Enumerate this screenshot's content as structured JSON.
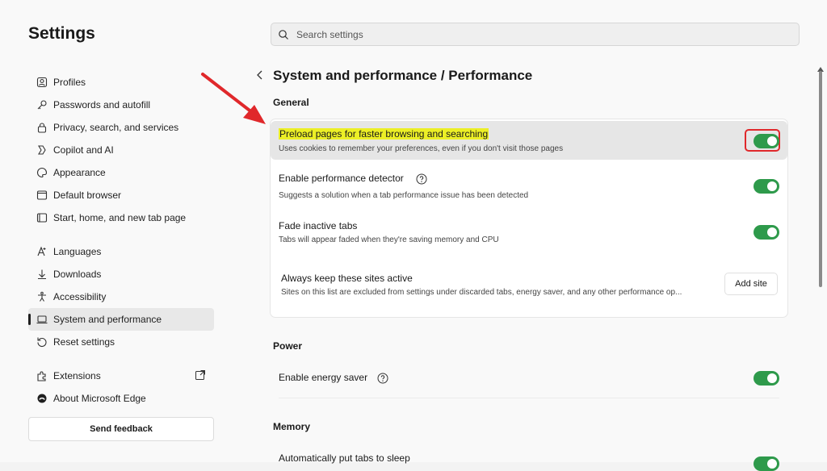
{
  "app": {
    "title": "Settings"
  },
  "search": {
    "placeholder": "Search settings"
  },
  "sidebar": {
    "items": [
      {
        "label": "Profiles",
        "icon": "profile-icon"
      },
      {
        "label": "Passwords and autofill",
        "icon": "key-icon"
      },
      {
        "label": "Privacy, search, and services",
        "icon": "lock-icon"
      },
      {
        "label": "Copilot and AI",
        "icon": "copilot-icon"
      },
      {
        "label": "Appearance",
        "icon": "palette-icon"
      },
      {
        "label": "Default browser",
        "icon": "browser-icon"
      },
      {
        "label": "Start, home, and new tab page",
        "icon": "home-page-icon"
      },
      {
        "label": "Languages",
        "icon": "languages-icon"
      },
      {
        "label": "Downloads",
        "icon": "download-icon"
      },
      {
        "label": "Accessibility",
        "icon": "accessibility-icon"
      },
      {
        "label": "System and performance",
        "icon": "laptop-icon",
        "active": true
      },
      {
        "label": "Reset settings",
        "icon": "reset-icon"
      },
      {
        "label": "Extensions",
        "icon": "extensions-icon"
      },
      {
        "label": "About Microsoft Edge",
        "icon": "edge-logo-icon"
      }
    ],
    "feedback_label": "Send feedback"
  },
  "main": {
    "breadcrumb": "System and performance / Performance",
    "sections": {
      "general": {
        "heading": "General",
        "rows": [
          {
            "title": "Preload pages for faster browsing and searching",
            "desc": "Uses cookies to remember your preferences, even if you don't visit those pages",
            "on": true
          },
          {
            "title": "Enable performance detector",
            "desc": "Suggests a solution when a tab performance issue has been detected",
            "on": true
          },
          {
            "title": "Fade inactive tabs",
            "desc": "Tabs will appear faded when they're saving memory and CPU",
            "on": true
          },
          {
            "title": "Always keep these sites active",
            "desc": "Sites on this list are excluded from settings under discarded tabs, energy saver, and any other performance op...",
            "button": "Add site"
          }
        ]
      },
      "power": {
        "heading": "Power",
        "rows": [
          {
            "title": "Enable energy saver",
            "on": true
          }
        ]
      },
      "memory": {
        "heading": "Memory",
        "rows": [
          {
            "title": "Automatically put tabs to sleep",
            "on": true
          }
        ]
      }
    }
  },
  "colors": {
    "toggle_on": "#2e9a4b",
    "highlight": "#ecef26",
    "annotation_red": "#e0282b"
  }
}
